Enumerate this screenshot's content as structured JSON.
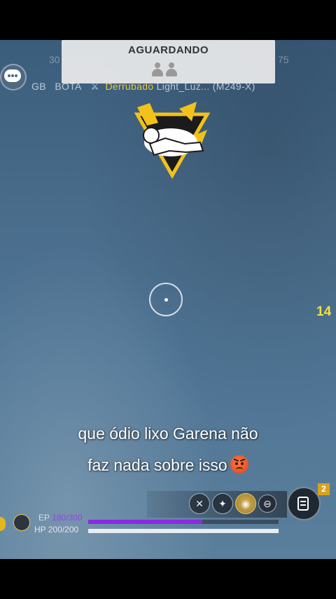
{
  "banner": {
    "title": "AGUARDANDO",
    "icon": "teammates-waiting-icon"
  },
  "killfeed": {
    "team": "GB",
    "player": "BOTA",
    "action": "Derrubado",
    "victim": "Light_Luz...",
    "weapon": "(M249-X)"
  },
  "faint_numbers": {
    "left": "30",
    "right": "75"
  },
  "side_counter": "14",
  "caption": {
    "line1": "que ódio lixo Garena não",
    "line2": "faz nada sobre isso",
    "emoji": "angry-face-emoji"
  },
  "stats": {
    "ep_label": "EP",
    "ep_value": "180/300",
    "ep_fraction": 0.6,
    "hp_label": "HP",
    "hp_value": "200/200",
    "hp_fraction": 1.0
  },
  "skills": [
    "ability-1-icon",
    "ability-2-icon",
    "ability-3-icon",
    "ability-4-icon"
  ],
  "inventory_badge": "2",
  "colors": {
    "ep": "#8a2be2",
    "hp": "#e8eef2",
    "accent": "#f0e23a"
  }
}
